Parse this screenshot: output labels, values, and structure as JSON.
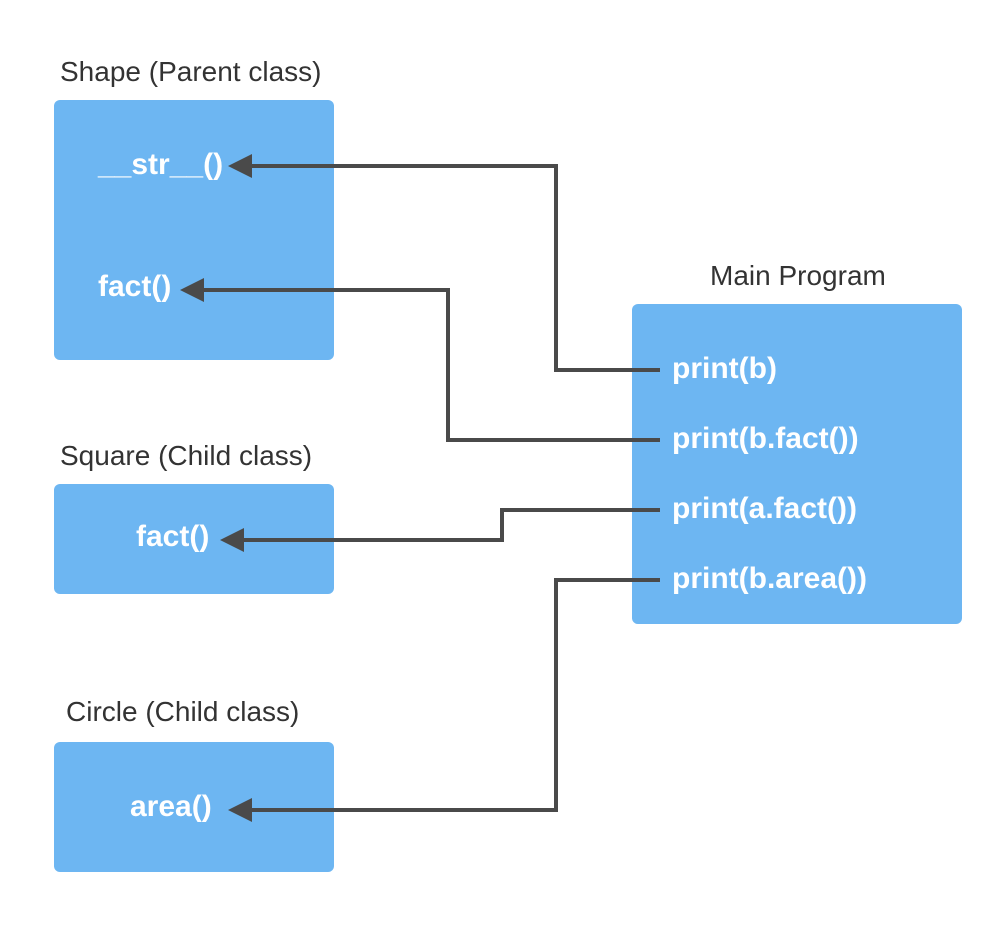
{
  "shape": {
    "title": "Shape (Parent class)",
    "methods": {
      "str": "__str__()",
      "fact": "fact()"
    }
  },
  "square": {
    "title": "Square (Child class)",
    "methods": {
      "fact": "fact()"
    }
  },
  "circle": {
    "title": "Circle (Child class)",
    "methods": {
      "area": "area()"
    }
  },
  "main": {
    "title": "Main Program",
    "statements": {
      "print_b": "print(b)",
      "print_b_fact": "print(b.fact())",
      "print_a_fact": "print(a.fact())",
      "print_b_area": "print(b.area())"
    }
  },
  "colors": {
    "box": "#6DB6F2",
    "text": "#333333",
    "connector": "#4A4A4A"
  }
}
